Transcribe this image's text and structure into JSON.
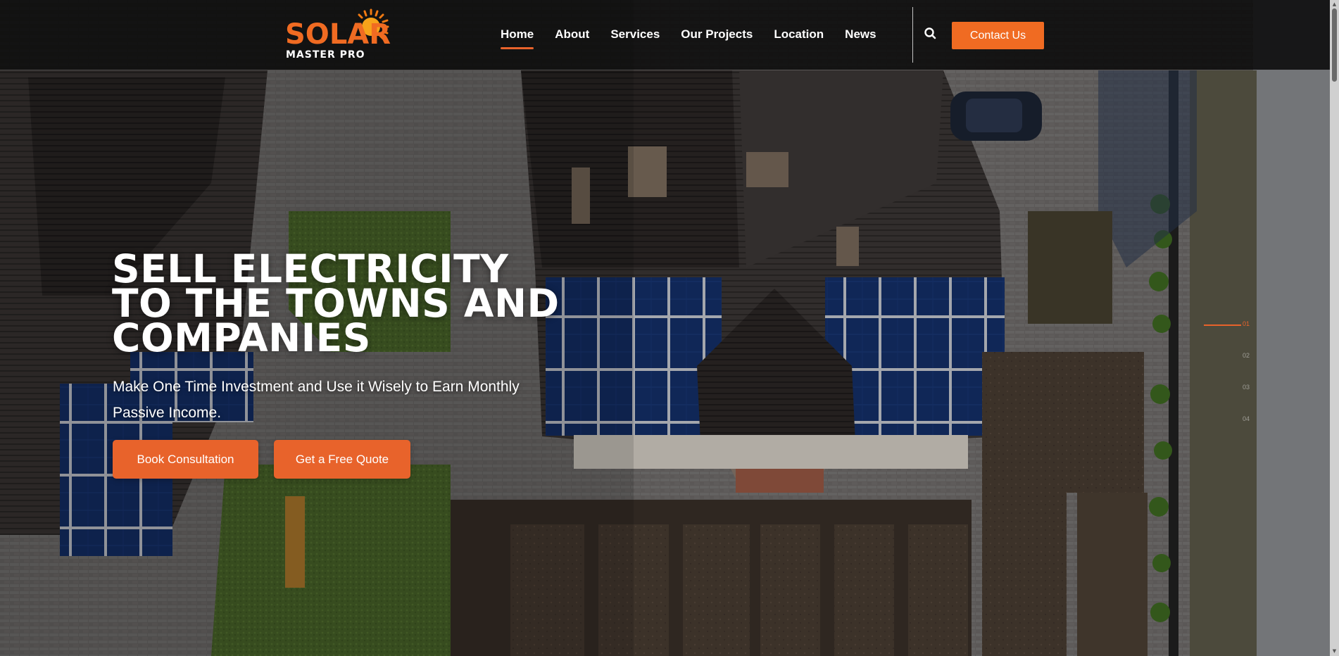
{
  "brand": {
    "logo_word": "SOLAR",
    "logo_tagline": "MASTER PRO",
    "accent_color": "#e8632b",
    "logo_sun_color": "#f7a21a"
  },
  "nav": {
    "items": [
      {
        "label": "Home",
        "active": true
      },
      {
        "label": "About",
        "active": false
      },
      {
        "label": "Services",
        "active": false
      },
      {
        "label": "Our Projects",
        "active": false
      },
      {
        "label": "Location",
        "active": false
      },
      {
        "label": "News",
        "active": false
      }
    ],
    "search_icon": "search-icon",
    "contact_label": "Contact Us"
  },
  "hero": {
    "title_lines": [
      "SELL ELECTRICITY",
      "TO THE TOWNS AND",
      "COMPANIES"
    ],
    "subtitle": "Make One Time Investment and Use it Wisely to Earn Monthly Passive Income.",
    "cta_primary": "Book Consultation",
    "cta_secondary": "Get a Free Quote"
  },
  "slider": {
    "pages": [
      "01",
      "02",
      "03",
      "04"
    ],
    "active_index": 0
  }
}
